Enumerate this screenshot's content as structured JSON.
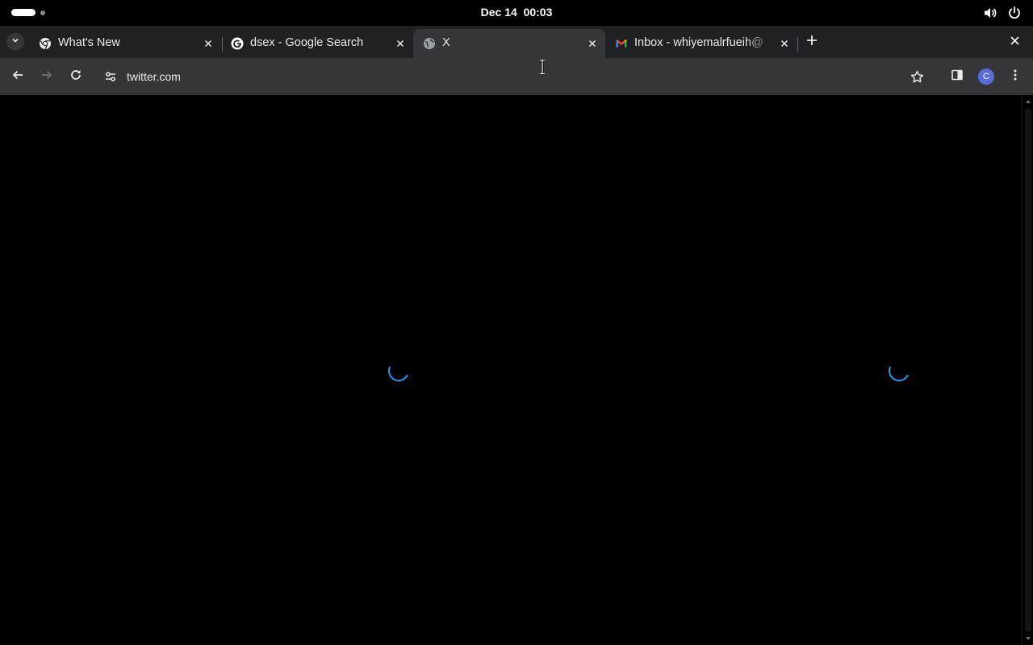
{
  "system": {
    "date": "Dec 14",
    "time": "00:03"
  },
  "tabs": [
    {
      "title": "What's New",
      "favicon": "chrome-icon",
      "active": false
    },
    {
      "title": "dsex - Google Search",
      "favicon": "google-icon",
      "active": false
    },
    {
      "title": "X",
      "favicon": "globe-icon",
      "active": true
    },
    {
      "title": "Inbox - whiyemalrfueih@",
      "favicon": "gmail-icon",
      "active": false
    }
  ],
  "toolbar": {
    "url": "twitter.com",
    "profile_initial": "C"
  },
  "colors": {
    "spinner": "#1d9bf0",
    "tabstrip": "#202124",
    "toolbar": "#35363a",
    "avatar": "#5b6bd8"
  }
}
